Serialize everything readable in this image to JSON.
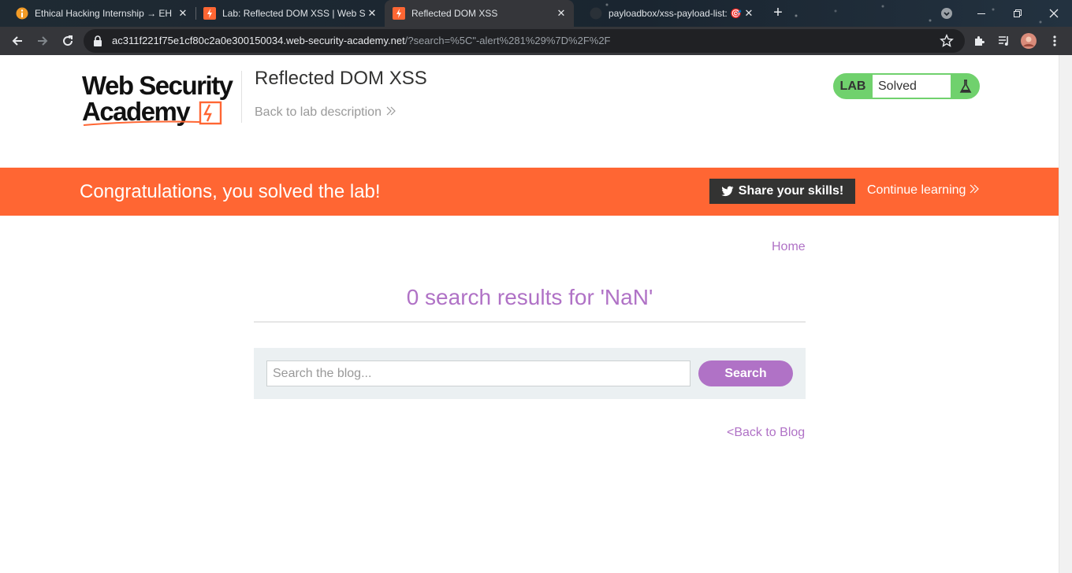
{
  "browser": {
    "tabs": [
      {
        "title": "Ethical Hacking Internship → EH",
        "favicon": "info-icon",
        "active": false
      },
      {
        "title": "Lab: Reflected DOM XSS | Web S",
        "favicon": "portswigger-icon",
        "active": false
      },
      {
        "title": "Reflected DOM XSS",
        "favicon": "portswigger-icon",
        "active": true
      },
      {
        "title": "payloadbox/xss-payload-list: 🎯",
        "favicon": "github-icon",
        "active": false
      }
    ],
    "url_host": "ac311f221f75e1cf80c2a0e300150034.web-security-academy.net",
    "url_rest": "/?search=%5C\"-alert%281%29%7D%2F%2F"
  },
  "header": {
    "logo_line1": "Web Security",
    "logo_line2": "Academy",
    "lab_title": "Reflected DOM XSS",
    "back_to_description": "Back to lab description",
    "status_label": "LAB",
    "status_value": "Solved"
  },
  "banner": {
    "message": "Congratulations, you solved the lab!",
    "share": "Share your skills!",
    "continue": "Continue learning"
  },
  "main": {
    "home": "Home",
    "results_heading": "0 search results for 'NaN'",
    "search_placeholder": "Search the blog...",
    "search_button": "Search",
    "back_to_blog": "<Back to Blog"
  },
  "colors": {
    "accent_orange": "#ff6633",
    "link_purple": "#b072c6",
    "solved_green": "#70d16d"
  }
}
